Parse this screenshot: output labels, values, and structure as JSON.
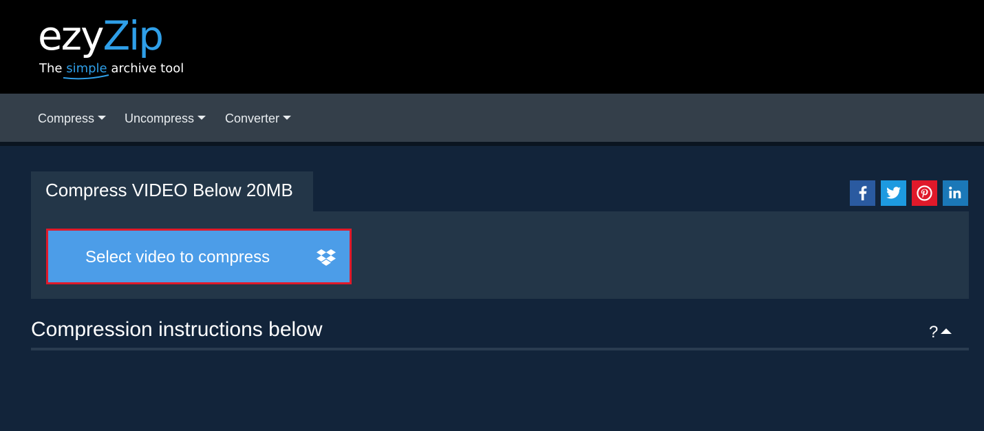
{
  "header": {
    "logo_ezy": "ezy",
    "logo_zip": "Zip",
    "tagline_before": "The ",
    "tagline_highlight": "simple",
    "tagline_after": " archive tool"
  },
  "nav": {
    "items": [
      {
        "label": "Compress"
      },
      {
        "label": "Uncompress"
      },
      {
        "label": "Converter"
      }
    ]
  },
  "card": {
    "title": "Compress VIDEO Below 20MB",
    "select_button_label": "Select video to compress",
    "select_button_icon": "dropbox-icon"
  },
  "social": [
    {
      "name": "facebook-icon",
      "color": "#2a5aa0"
    },
    {
      "name": "twitter-icon",
      "color": "#1d9ae0"
    },
    {
      "name": "pinterest-icon",
      "color": "#e0192a"
    },
    {
      "name": "linkedin-icon",
      "color": "#1b78b8"
    }
  ],
  "instructions": {
    "title": "Compression instructions below",
    "toggle_label": "?"
  },
  "colors": {
    "brand_blue": "#2f9fe8",
    "button_blue": "#4c9de8",
    "highlight_red": "#e0192a",
    "page_bg": "#12243a",
    "card_bg": "#233648",
    "nav_bg": "#343f4a"
  }
}
